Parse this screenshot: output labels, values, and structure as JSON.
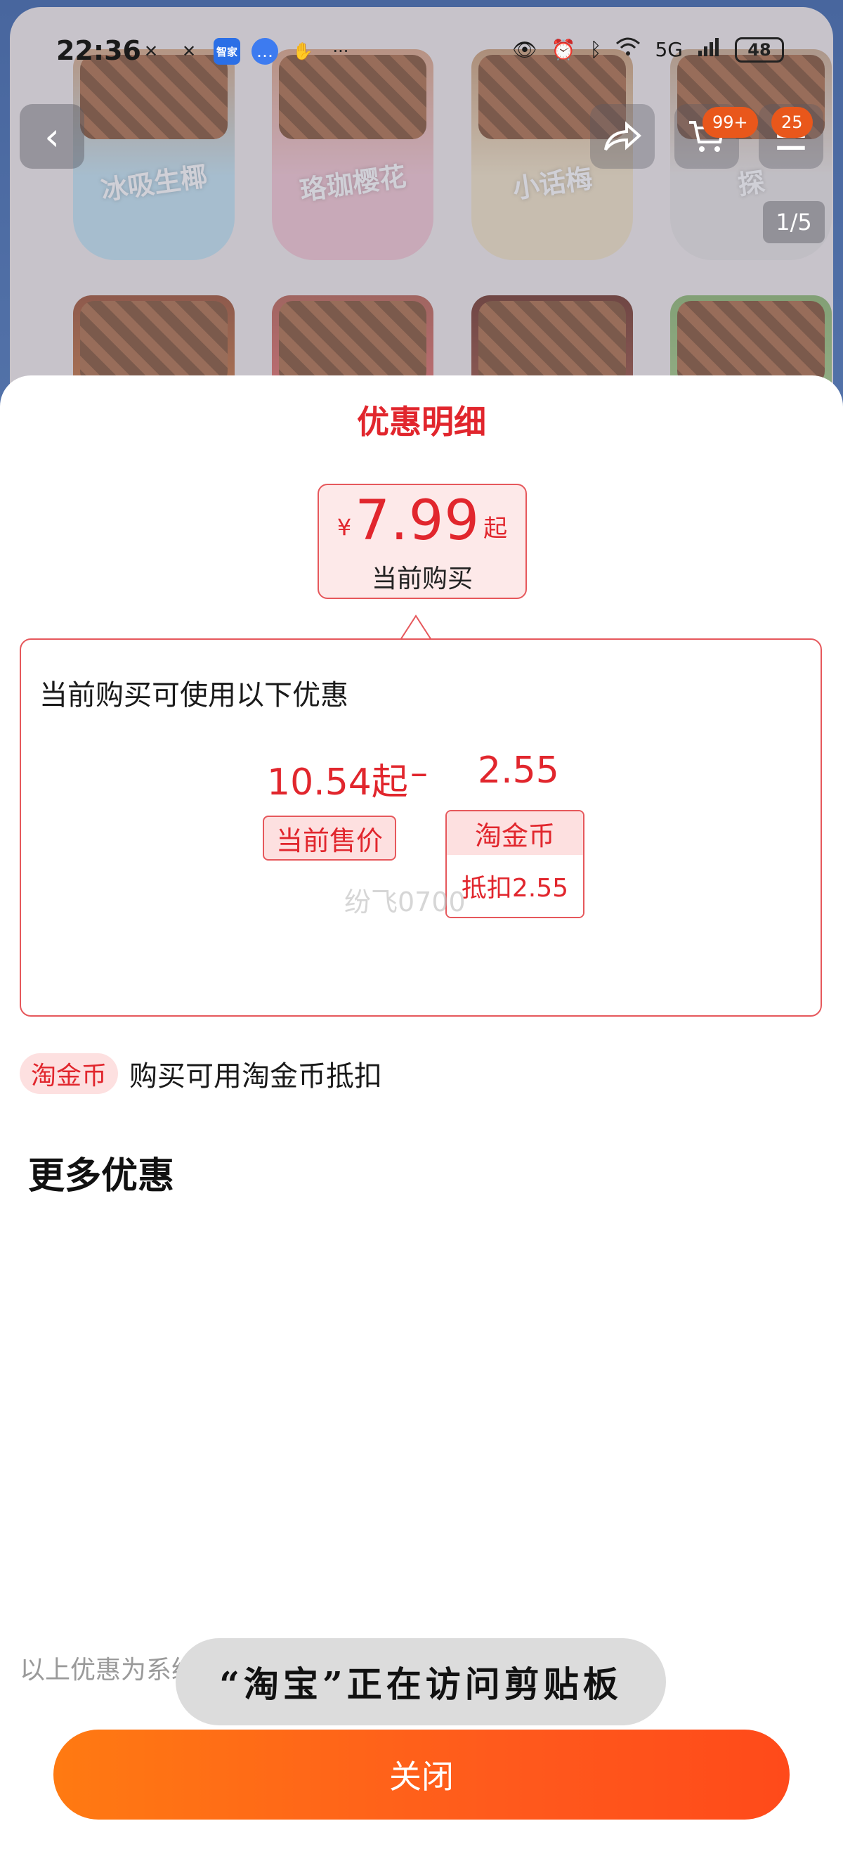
{
  "status_bar": {
    "time": "22:36",
    "app_badge_1": "智家",
    "signal_label": "5G",
    "battery": "48"
  },
  "product_header": {
    "cup_labels": [
      "冰吸生椰",
      "珞珈樱花",
      "小话梅",
      "探"
    ],
    "cart_badge": "99+",
    "message_badge": "25",
    "pager": "1/5"
  },
  "sheet": {
    "title": "优惠明细",
    "price": {
      "currency": "¥",
      "value": "7.99",
      "suffix": "起",
      "label": "当前购买"
    },
    "detail": {
      "heading": "当前购买可使用以下优惠",
      "current_price": "10.54起",
      "operator": "–",
      "discount_value": "2.55",
      "current_price_tag": "当前售价",
      "coin_card_title": "淘金币",
      "coin_card_detail": "抵扣2.55",
      "watermark": "纷飞0700"
    },
    "coin_note": {
      "pill": "淘金币",
      "text": "购买可用淘金币抵扣"
    },
    "more_section_title": "更多优惠",
    "disclaimer": "以上优惠为系统推荐，详情 >",
    "toast": "“淘宝”正在访问剪贴板",
    "close_button": "关闭"
  },
  "colors": {
    "accent_red": "#e1262d",
    "button_orange": "#ff6a14"
  },
  "icons": [
    "back-icon",
    "share-icon",
    "cart-icon",
    "message-icon",
    "eye-icon",
    "alarm-icon",
    "bluetooth-icon",
    "wifi-icon",
    "signal-icon",
    "battery-icon"
  ]
}
